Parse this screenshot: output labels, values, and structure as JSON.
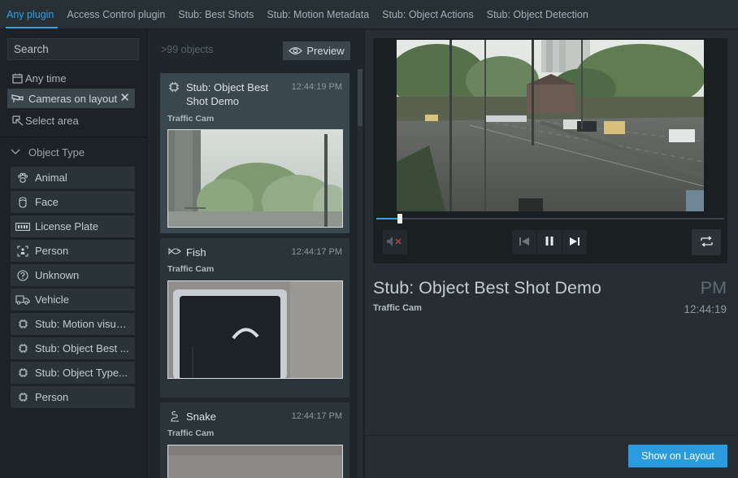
{
  "tabs": [
    {
      "label": "Any plugin",
      "active": true
    },
    {
      "label": "Access Control plugin"
    },
    {
      "label": "Stub: Best Shots"
    },
    {
      "label": "Stub: Motion Metadata"
    },
    {
      "label": "Stub: Object Actions"
    },
    {
      "label": "Stub: Object Detection"
    }
  ],
  "filters": {
    "search_placeholder": "Search",
    "any_time": "Any time",
    "cameras_on_layout": "Cameras on layout",
    "select_area": "Select area",
    "object_type_header": "Object Type",
    "object_types": [
      {
        "label": "Animal",
        "icon": "paw-icon"
      },
      {
        "label": "Face",
        "icon": "face-icon"
      },
      {
        "label": "License Plate",
        "icon": "license-plate-icon"
      },
      {
        "label": "Person",
        "icon": "person-icon"
      },
      {
        "label": "Unknown",
        "icon": "question-icon"
      },
      {
        "label": "Vehicle",
        "icon": "vehicle-icon"
      },
      {
        "label": "Stub: Motion visua...",
        "icon": "chip-icon"
      },
      {
        "label": "Stub: Object Best ...",
        "icon": "chip-icon"
      },
      {
        "label": "Stub: Object Type...",
        "icon": "chip-icon"
      },
      {
        "label": "Person",
        "icon": "chip-icon"
      }
    ]
  },
  "list": {
    "count": ">99 objects",
    "preview_label": "Preview",
    "cards": [
      {
        "title": "Stub: Object Best Shot Demo",
        "time": "12:44:19 PM",
        "camera": "Traffic Cam",
        "icon": "chip-icon"
      },
      {
        "title": "Fish",
        "time": "12:44:17 PM",
        "camera": "Traffic Cam",
        "icon": "fish-icon"
      },
      {
        "title": "Snake",
        "time": "12:44:17 PM",
        "camera": "Traffic Cam",
        "icon": "snake-icon"
      }
    ]
  },
  "detail": {
    "title": "Stub: Object Best Shot Demo",
    "camera": "Traffic Cam",
    "ampm": "PM",
    "time": "12:44:19",
    "show_on_layout": "Show on Layout",
    "playback_progress": 0.065
  },
  "colors": {
    "accent": "#2fa3e3",
    "button": "#2b9be0"
  }
}
